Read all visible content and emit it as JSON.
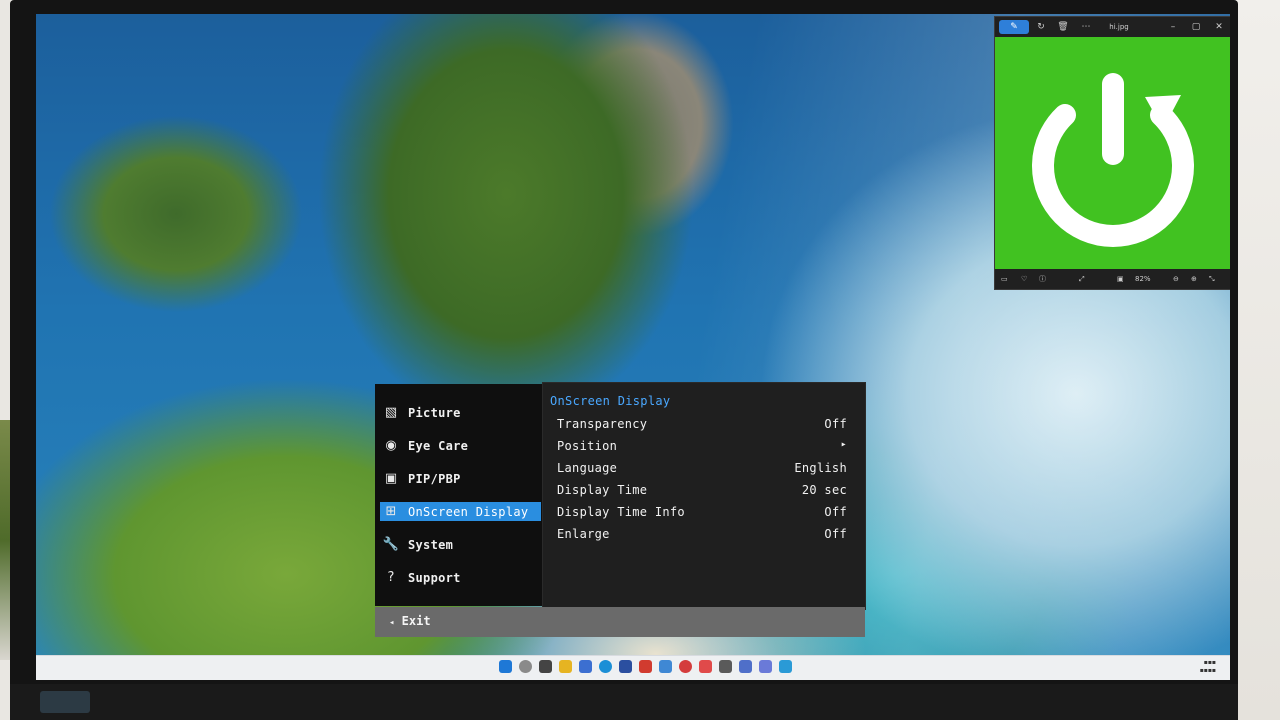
{
  "osd": {
    "menu": [
      {
        "label": "Picture",
        "icon": "picture-icon"
      },
      {
        "label": "Eye Care",
        "icon": "eye-icon"
      },
      {
        "label": "PIP/PBP",
        "icon": "pip-icon"
      },
      {
        "label": "OnScreen Display",
        "icon": "osd-icon"
      },
      {
        "label": "System",
        "icon": "wrench-icon"
      },
      {
        "label": "Support",
        "icon": "support-icon"
      }
    ],
    "selected_index": 3,
    "panel_title": "OnScreen Display",
    "settings": [
      {
        "name": "Transparency",
        "value": "Off"
      },
      {
        "name": "Position",
        "value": "▸"
      },
      {
        "name": "Language",
        "value": "English"
      },
      {
        "name": "Display Time",
        "value": "20 sec"
      },
      {
        "name": "Display Time Info",
        "value": "Off"
      },
      {
        "name": "Enlarge",
        "value": "Off"
      }
    ],
    "exit_label": "Exit",
    "exit_icon": "◂"
  },
  "viewer": {
    "filename": "hi.jpg",
    "zoom": "82%",
    "image_bg": "#41c221",
    "image_icon": "power-icon"
  },
  "colors": {
    "osd_accent": "#2a8ee0",
    "osd_title": "#4aa8ff"
  }
}
